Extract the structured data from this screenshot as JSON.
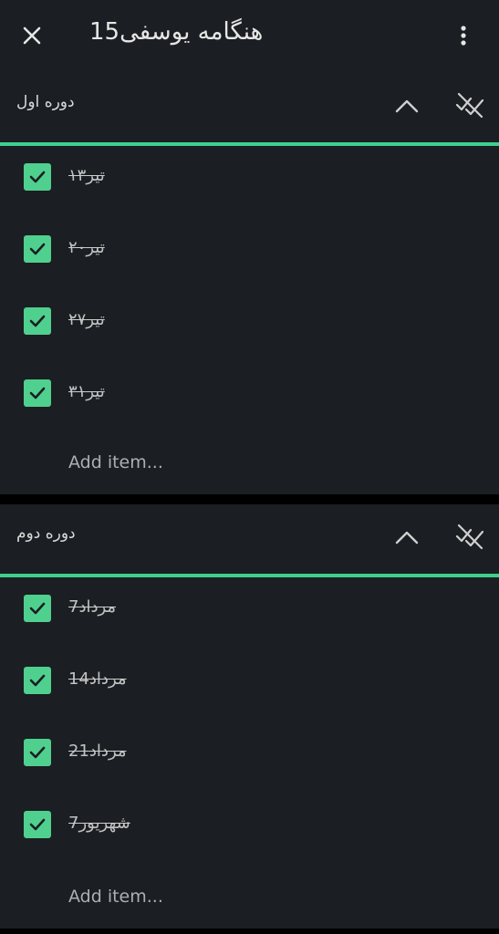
{
  "app": {
    "title": "هنگامه یوسفی15",
    "close_icon": "close-icon",
    "more_icon": "more-vertical-icon"
  },
  "colors": {
    "background": "#1b1e22",
    "accent": "#3ecf8e",
    "checkbox": "#4fd08f"
  },
  "sections": [
    {
      "title": "دوره اول",
      "items": [
        {
          "label": "تیر۱۳",
          "checked": true
        },
        {
          "label": "تیر۲۰",
          "checked": true
        },
        {
          "label": "تیر۲۷",
          "checked": true
        },
        {
          "label": "تیر۳۱",
          "checked": true
        }
      ],
      "add_item_label": "Add item..."
    },
    {
      "title": "دوره دوم",
      "items": [
        {
          "label": "مرداد7",
          "checked": true
        },
        {
          "label": "مرداد14",
          "checked": true
        },
        {
          "label": "مرداد21",
          "checked": true
        },
        {
          "label": "شهریور7",
          "checked": true
        }
      ],
      "add_item_label": "Add item..."
    }
  ]
}
